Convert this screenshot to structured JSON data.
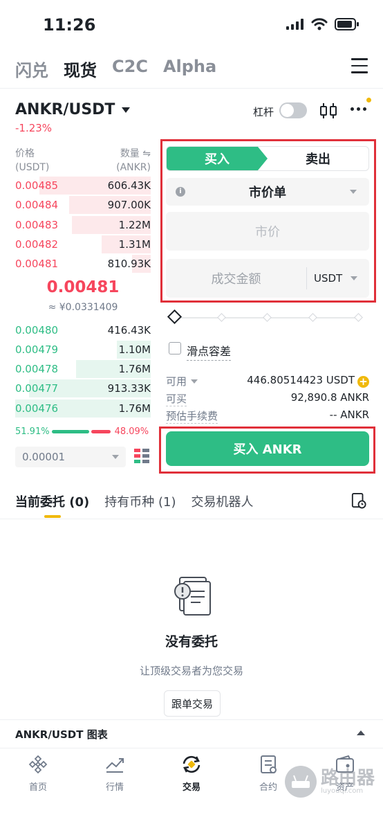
{
  "status_bar": {
    "time": "11:26"
  },
  "top_tabs": [
    "闪兑",
    "现货",
    "C2C",
    "Alpha"
  ],
  "pair": {
    "name": "ANKR/USDT",
    "change": "-1.23%",
    "margin_label": "杠杆"
  },
  "orderbook": {
    "price_header": "价格",
    "price_unit": "(USDT)",
    "qty_header": "数量 ⇋",
    "qty_unit": "(ANKR)",
    "asks": [
      {
        "price": "0.00485",
        "qty": "606.43K",
        "depth": 0.82
      },
      {
        "price": "0.00484",
        "qty": "907.00K",
        "depth": 0.6
      },
      {
        "price": "0.00483",
        "qty": "1.22M",
        "depth": 0.58
      },
      {
        "price": "0.00482",
        "qty": "1.31M",
        "depth": 0.36
      },
      {
        "price": "0.00481",
        "qty": "810.93K",
        "depth": 0.14
      }
    ],
    "last_price": "0.00481",
    "last_price_fiat": "≈ ¥0.0331409",
    "bids": [
      {
        "price": "0.00480",
        "qty": "416.43K",
        "depth": 0.0
      },
      {
        "price": "0.00479",
        "qty": "1.10M",
        "depth": 0.25
      },
      {
        "price": "0.00478",
        "qty": "1.76M",
        "depth": 0.55
      },
      {
        "price": "0.00477",
        "qty": "913.33K",
        "depth": 0.9
      },
      {
        "price": "0.00476",
        "qty": "1.76M",
        "depth": 1.0
      }
    ],
    "buy_ratio": "51.91%",
    "sell_ratio": "48.09%",
    "precision": "0.00001"
  },
  "form": {
    "buy_tab": "买入",
    "sell_tab": "卖出",
    "order_type": "市价单",
    "price_placeholder": "市价",
    "amount_placeholder": "成交金额",
    "amount_unit": "USDT",
    "slippage_label": "滑点容差",
    "available_label": "可用",
    "available_value": "446.80514423 USDT",
    "can_buy_label": "可买",
    "can_buy_value": "92,890.8 ANKR",
    "fee_label": "预估手续费",
    "fee_value": "-- ANKR",
    "buy_button": "买入 ANKR"
  },
  "order_tabs": [
    "当前委托 (0)",
    "持有币种 (1)",
    "交易机器人"
  ],
  "empty": {
    "title": "没有委托",
    "subtitle": "让顶级交易者为您交易",
    "button": "跟单交易"
  },
  "chart_bar": {
    "label": "ANKR/USDT 图表"
  },
  "bottom_nav": [
    "首页",
    "行情",
    "交易",
    "合约",
    "资产"
  ],
  "watermark": {
    "title": "路由器",
    "sub": "luyouqi.com"
  },
  "colors": {
    "green": "#2ebd85",
    "red": "#f6465d",
    "yellow": "#f0b90b",
    "highlight": "#e0303a"
  }
}
